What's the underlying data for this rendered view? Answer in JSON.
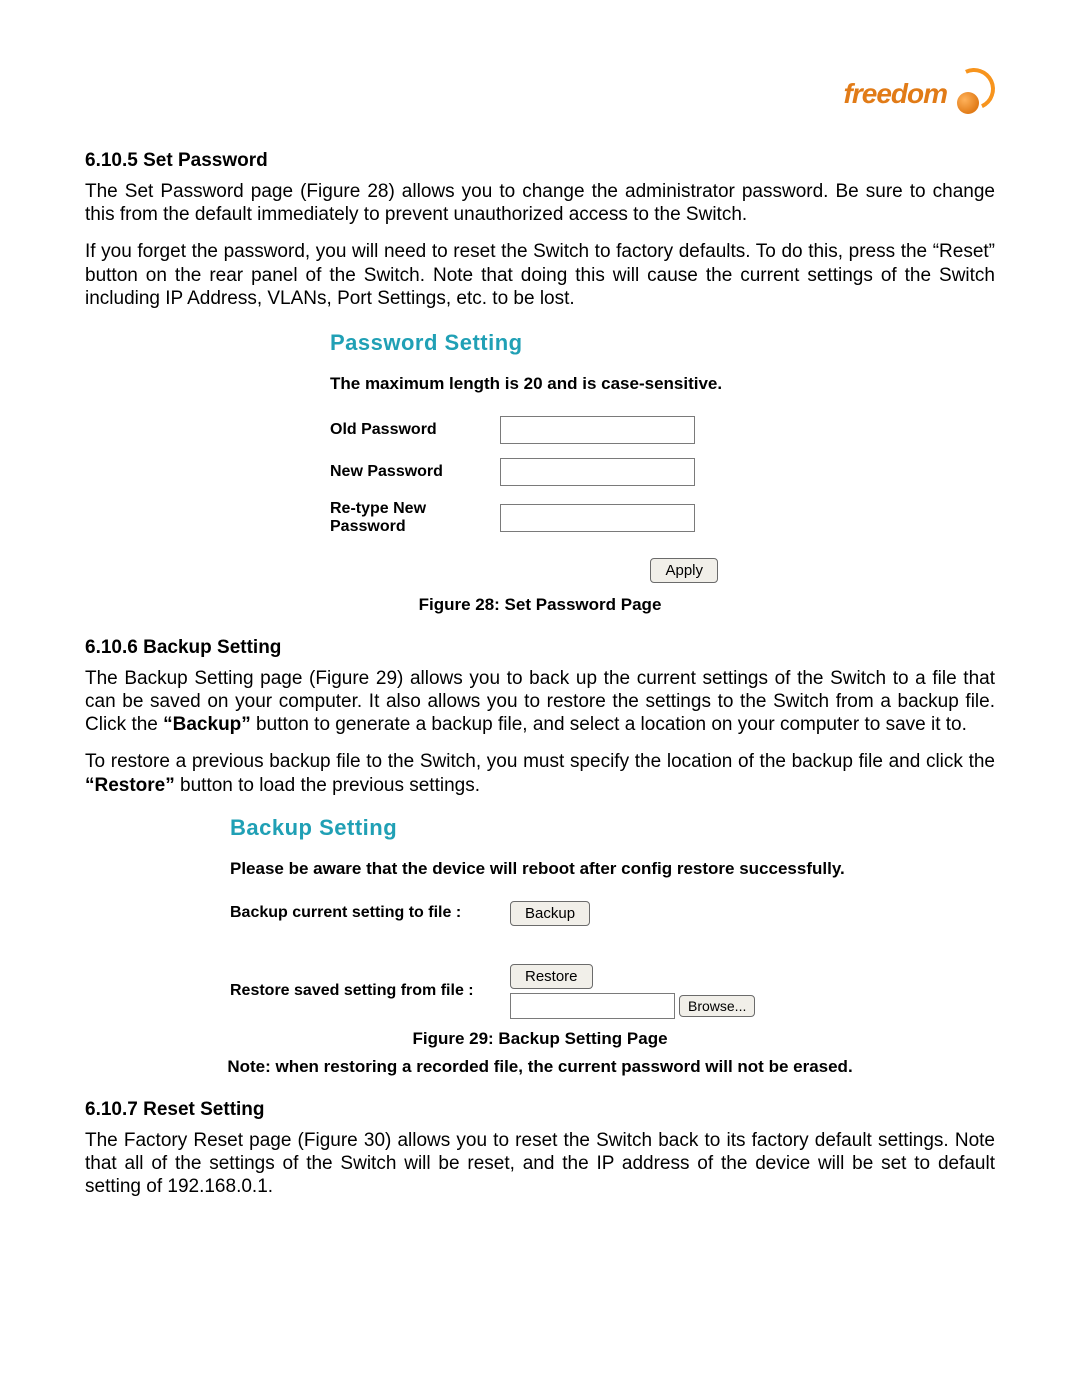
{
  "logo": {
    "brand": "freedom"
  },
  "sections": {
    "setPassword": {
      "heading": "6.10.5 Set Password",
      "para1": "The Set Password page (Figure 28) allows you to change the administrator password.  Be sure to change this from the default immediately to prevent unauthorized access to the Switch.",
      "para2": "If you forget the password, you will need to reset the Switch to factory defaults.  To do this, press the “Reset” button on the rear panel of the Switch.  Note that doing this will cause the current settings of the Switch including IP Address, VLANs, Port Settings, etc. to be lost.",
      "figCaption": "Figure 28: Set Password Page"
    },
    "backupSetting": {
      "heading": "6.10.6 Backup Setting",
      "para1_a": "The Backup Setting page (Figure 29) allows you to back up the current settings of the Switch to a file that can be saved on your computer.  It also allows you to restore the settings to the Switch from a backup file.    Click the ",
      "para1_bold": "“Backup”",
      "para1_b": " button to generate a backup file, and select a location on your computer to save it to.",
      "para2_a": "To restore a previous backup file to the Switch, you must specify the location of the backup file and click the ",
      "para2_bold": "“Restore”",
      "para2_b": " button to load the previous settings.",
      "figCaption": "Figure 29: Backup Setting Page",
      "note": "Note: when restoring a recorded file, the current password will not be erased."
    },
    "resetSetting": {
      "heading": "6.10.7 Reset Setting",
      "para1": "The Factory Reset page (Figure 30) allows you to reset the Switch back to its factory default settings.  Note that all of the settings of the Switch will be reset, and the IP address of the device will be set to default setting of 192.168.0.1."
    }
  },
  "passwordPanel": {
    "title": "Password Setting",
    "subtitle": "The maximum length is 20 and is case-sensitive.",
    "oldLabel": "Old Password",
    "newLabel": "New Password",
    "retypeLabel": "Re-type New Password",
    "applyLabel": "Apply"
  },
  "backupPanel": {
    "title": "Backup Setting",
    "warning": "Please be aware that the device will reboot after config restore successfully.",
    "backupLabel": "Backup current setting to file :",
    "backupBtn": "Backup",
    "restoreLabel": "Restore saved setting from file :",
    "restoreBtn": "Restore",
    "browseBtn": "Browse..."
  }
}
